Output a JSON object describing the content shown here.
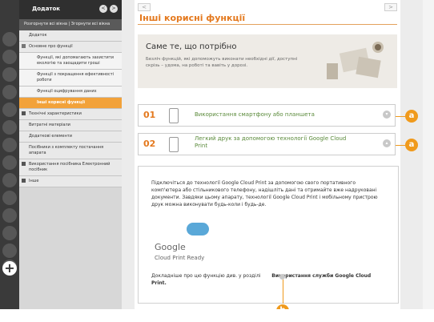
{
  "sidebar": {
    "title": "Додаток",
    "expand_collapse": "Розгорнути всі вікна | Згорнути всі вікна",
    "items": [
      {
        "label": "Додаток",
        "level": 0
      },
      {
        "label": "Основне про функції",
        "level": 0
      },
      {
        "label": "Функції, які допомагають захистити екологію та заощадити гроші",
        "level": 1
      },
      {
        "label": "Функції з покращення ефективності роботи",
        "level": 1
      },
      {
        "label": "Функції оцифрування даних",
        "level": 1
      },
      {
        "label": "Інші корисні функції",
        "level": 1
      },
      {
        "label": "Технічні характеристики",
        "level": 0
      },
      {
        "label": "Витратні матеріали",
        "level": 0
      },
      {
        "label": "Додаткові елементи",
        "level": 0
      },
      {
        "label": "Посібники з комплекту постачання апарата",
        "level": 0
      },
      {
        "label": "Використання посібника Електронний посібник",
        "level": 0
      },
      {
        "label": "Інше",
        "level": 0
      }
    ],
    "active_index": 5
  },
  "nav": {
    "prev": "<",
    "next": ">"
  },
  "page": {
    "title": "Інші корисні функції",
    "banner_heading": "Саме те, що потрібно",
    "banner_text": "Безліч функцій, які допоможуть виконати необхідні дії, доступні скрізь – удома, на роботі та вавіть у дорозі.",
    "features": [
      {
        "num": "01",
        "label": "Використання смартфону або планшета",
        "callout": "a"
      },
      {
        "num": "02",
        "label": "Легкий друк за допомогою технології Google Cloud Print",
        "callout": "a"
      }
    ],
    "detail_text": "Підключіться до технології Google Cloud Print за допомогою свого портативного комп'ютера або стільникового телефону, надішліть дані та отримайте вже надруковані документи. Завдяки цьому апарату, технології Google Cloud Print і мобільному пристрою друк можна виконувати будь-коли і будь-де.",
    "logo_google": "Google",
    "logo_caption": "Cloud Print Ready",
    "ref_prefix": "Докладніше про цю функцію див. у розділі",
    "ref_link": "Використання служби Google Cloud Print.",
    "ref_callout": "b"
  },
  "colors": {
    "accent": "#e4791e",
    "callout": "#f09a1c",
    "link_green": "#5a8a3a",
    "active_item": "#f2a23a"
  }
}
